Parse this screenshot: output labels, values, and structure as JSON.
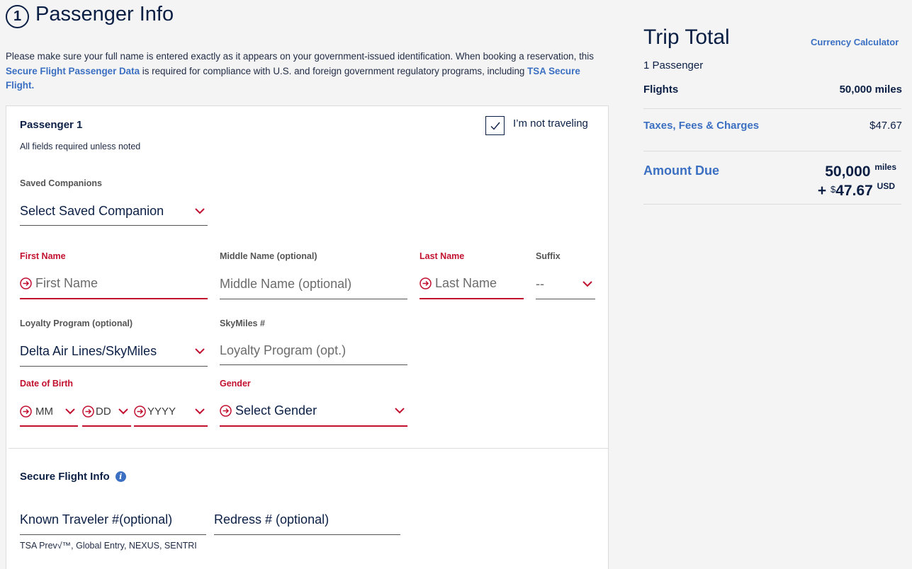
{
  "header": {
    "step": "1",
    "title": "Passenger Info"
  },
  "intro": {
    "text_1": "Please make sure your full name is entered exactly as it appears on your government-issued identification. When booking a reservation, this ",
    "link_1": "Secure Flight Passenger Data",
    "text_2": " is required for compliance with U.S. and foreign government regulatory programs, including ",
    "link_2": "TSA Secure Flight."
  },
  "passenger": {
    "title": "Passenger 1",
    "note": "All fields required unless noted",
    "not_traveling_label": "I’m not traveling",
    "saved_companions": {
      "label": "Saved Companions",
      "value": "Select Saved Companion"
    },
    "first_name": {
      "label": "First Name",
      "placeholder": "First Name"
    },
    "middle_name": {
      "label": "Middle Name (optional)",
      "placeholder": "Middle Name (optional)"
    },
    "last_name": {
      "label": "Last Name",
      "placeholder": "Last Name"
    },
    "suffix": {
      "label": "Suffix",
      "value": "--"
    },
    "loyalty_program": {
      "label": "Loyalty Program (optional)",
      "value": "Delta Air Lines/SkyMiles"
    },
    "skymiles": {
      "label": "SkyMiles #",
      "placeholder": "Loyalty Program (opt.)"
    },
    "dob": {
      "label": "Date of Birth",
      "month": "MM",
      "day": "DD",
      "year": "YYYY"
    },
    "gender": {
      "label": "Gender",
      "value": "Select Gender"
    }
  },
  "secure_flight": {
    "title": "Secure Flight Info",
    "known_traveler": {
      "placeholder": "Known Traveler #(optional)"
    },
    "redress": {
      "placeholder": "Redress # (optional)"
    },
    "known_traveler_note": "TSA Prev√™, Global Entry, NEXUS, SENTRI"
  },
  "trip_total": {
    "title": "Trip Total",
    "currency_link": "Currency Calculator",
    "passengers": "1 Passenger",
    "flights_label": "Flights",
    "flights_value": "50,000 miles",
    "taxes_label": "Taxes, Fees & Charges",
    "taxes_value": "$47.67",
    "amount_due_label": "Amount Due",
    "amount_miles": "50,000",
    "miles_unit": "miles",
    "plus": "+",
    "usd_symbol": "$",
    "amount_usd": "47.67",
    "usd_unit": "USD"
  },
  "colors": {
    "navy": "#0b1f45",
    "link_blue": "#3b6fc2",
    "error_red": "#c2102f"
  }
}
